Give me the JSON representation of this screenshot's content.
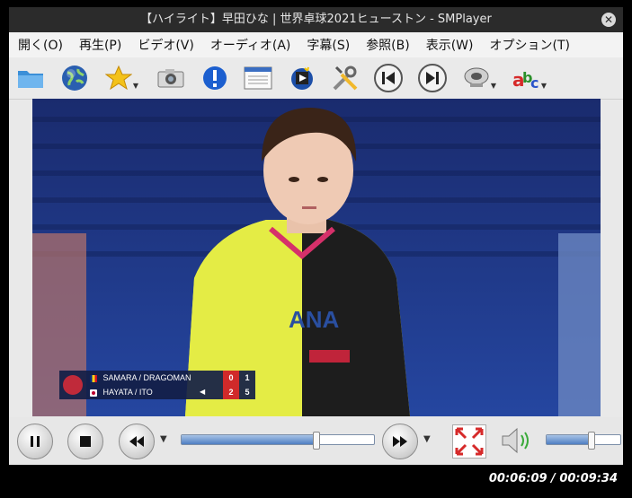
{
  "window": {
    "title": "【ハイライト】早田ひな | 世界卓球2021ヒューストン - SMPlayer"
  },
  "menu": [
    {
      "label": "開く(O)"
    },
    {
      "label": "再生(P)"
    },
    {
      "label": "ビデオ(V)"
    },
    {
      "label": "オーディオ(A)"
    },
    {
      "label": "字幕(S)"
    },
    {
      "label": "参照(B)"
    },
    {
      "label": "表示(W)"
    },
    {
      "label": "オプション(T)"
    }
  ],
  "toolbar_icons": [
    "folder-icon",
    "globe-icon",
    "star-icon",
    "camera-icon",
    "info-icon",
    "playlist-icon",
    "video-effects-icon",
    "tools-icon",
    "previous-icon",
    "next-icon",
    "audio-icon",
    "subtitles-icon"
  ],
  "scoreboard": {
    "row1": {
      "names": "SAMARA / DRAGOMAN",
      "game": "0",
      "set": "1"
    },
    "row2": {
      "names": "HAYATA / ITO",
      "game": "2",
      "set": "5"
    }
  },
  "playback": {
    "current": "00:06:09",
    "total": "00:09:34",
    "display": "00:06:09 / 00:09:34",
    "progress": 0.695,
    "volume": 0.6
  },
  "colors": {
    "accent": "#4f7fc3",
    "scoreboard_bg": "#141e46",
    "score_red": "#d02a2a"
  }
}
